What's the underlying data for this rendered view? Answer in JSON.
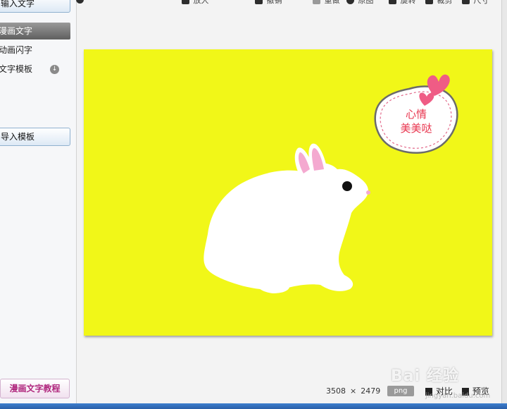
{
  "toolbar": {
    "items": [
      {
        "label": "放大",
        "icon": "zoom-in-icon"
      },
      {
        "label": "撤销",
        "icon": "undo-icon"
      },
      {
        "label": "重做",
        "icon": "redo-icon"
      },
      {
        "label": "原图",
        "icon": "original-icon"
      },
      {
        "label": "旋转",
        "icon": "rotate-icon"
      },
      {
        "label": "裁剪",
        "icon": "crop-icon"
      },
      {
        "label": "尺寸",
        "icon": "resize-icon"
      }
    ]
  },
  "sidebar": {
    "input_text_button": "输入文字",
    "items": [
      {
        "label": "漫画文字",
        "selected": true
      },
      {
        "label": "动画闪字",
        "selected": false
      },
      {
        "label": "文字模板",
        "selected": false
      }
    ],
    "import_template_button": "导入模板",
    "tutorial_button": "漫画文字教程"
  },
  "canvas": {
    "background_color": "#f1f718",
    "bubble_line1": "心情",
    "bubble_line2": "美美哒"
  },
  "status": {
    "width": "3508",
    "times": "×",
    "height": "2479",
    "format": "png",
    "compare_label": "对比",
    "preview_label": "预览"
  },
  "watermark": {
    "text": "Bai 经验",
    "sub": "jingyan.baidu.com"
  }
}
